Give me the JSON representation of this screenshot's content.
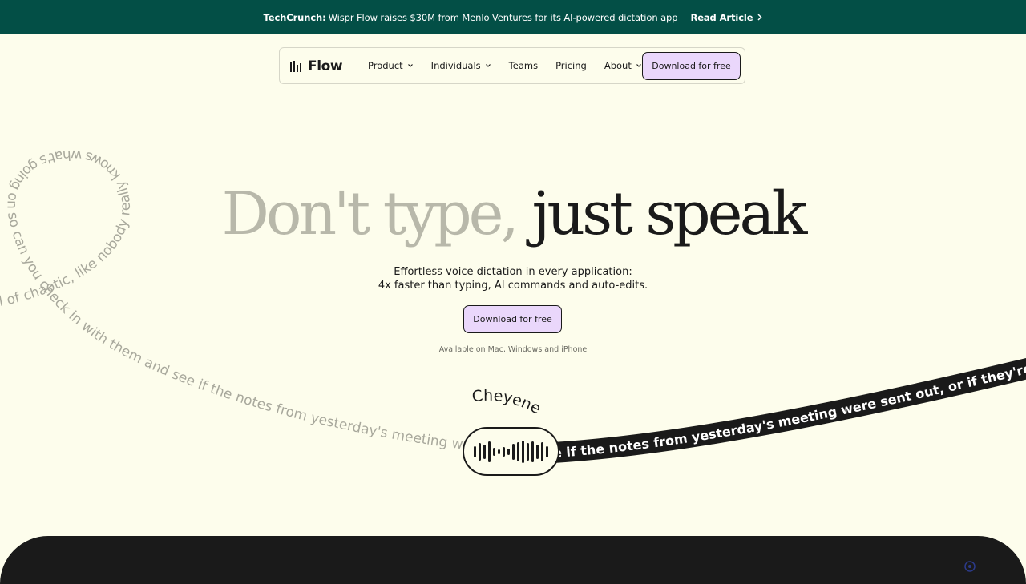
{
  "announcement": {
    "source": "TechCrunch:",
    "text": "Wispr Flow raises $30M from Menlo Ventures for its AI-powered dictation app",
    "link_label": "Read Article"
  },
  "nav": {
    "logo_text": "Flow",
    "items": [
      {
        "label": "Product",
        "has_dropdown": true
      },
      {
        "label": "Individuals",
        "has_dropdown": true
      },
      {
        "label": "Teams",
        "has_dropdown": false
      },
      {
        "label": "Pricing",
        "has_dropdown": false
      },
      {
        "label": "About",
        "has_dropdown": true
      }
    ],
    "cta_label": "Download for free"
  },
  "hero": {
    "headline_light": "Don't type,",
    "headline_dark": "just speak",
    "subline_1": "Effortless voice dictation in every application:",
    "subline_2": "4x faster than typing, AI commands and auto-edits.",
    "cta_label": "Download for free",
    "availability": "Available on Mac, Windows and iPhone"
  },
  "ribbon": {
    "loop_text": "l of chaotic, like nobody really knows what's going on so can you check in with them and see if the notes from yesterday's meeting were sen",
    "banner_text": "e if the notes from yesterday's meeting were sent out, or if they're st",
    "spoken_word": "Cheyene"
  },
  "colors": {
    "announce_bg": "#034f46",
    "page_bg": "#fdfdec",
    "cta_bg": "#ead7fb",
    "ink": "#1a1a1a",
    "muted_headline": "#b8b8aa"
  }
}
